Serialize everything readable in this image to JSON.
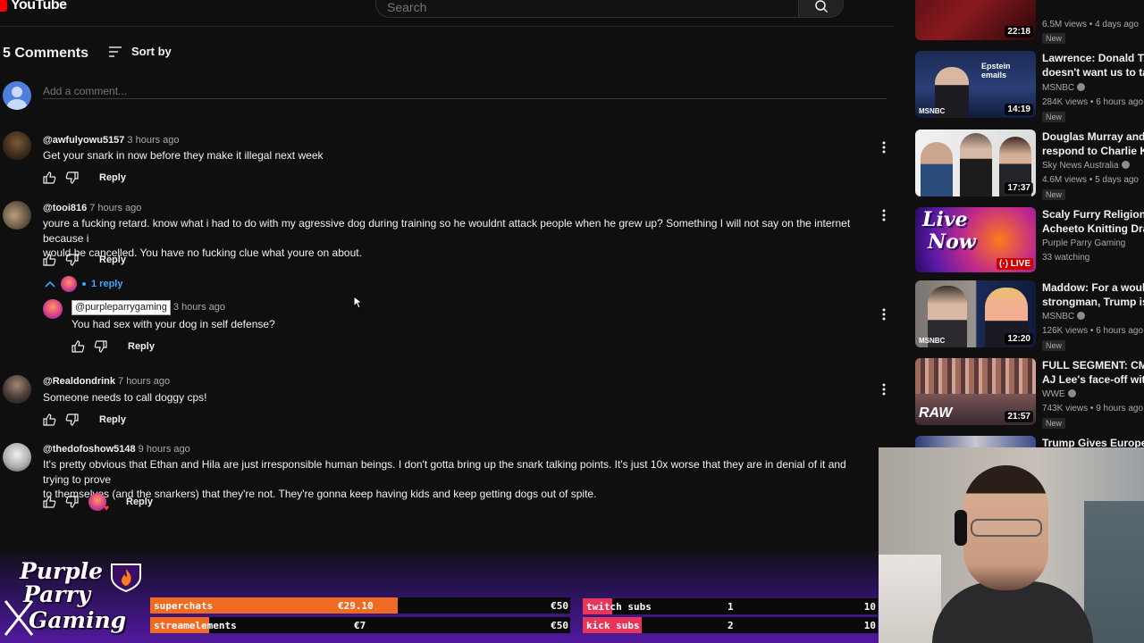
{
  "header": {
    "logo_text": "YouTube",
    "search_placeholder": "Search"
  },
  "comments_header": {
    "count_label": "5 Comments",
    "sort_label": "Sort by",
    "add_comment_placeholder": "Add a comment..."
  },
  "comments": [
    {
      "author": "@awfulyowu5157",
      "time": "3 hours ago",
      "text": "Get your snark in now before they make it illegal next week",
      "reply_label": "Reply"
    },
    {
      "author": "@tooi816",
      "time": "7 hours ago",
      "text_line1": "youre a fucking retard. know what i had to do with my agressive dog during training so he wouldnt attack people when he grew up? Something I will not say on the internet because i",
      "text_line2": "would be cancelled. You have no fucking clue what youre on about.",
      "reply_label": "Reply",
      "replies_toggle": "1 reply",
      "reply": {
        "author": "@purpleparrygaming",
        "time": "3 hours ago",
        "text": "You had sex with your dog in self defense?",
        "reply_label": "Reply"
      }
    },
    {
      "author": "@Realdondrink",
      "time": "7 hours ago",
      "text": "Someone needs to call doggy cps!",
      "reply_label": "Reply"
    },
    {
      "author": "@thedofoshow5148",
      "time": "9 hours ago",
      "text_line1": "It's pretty obvious that Ethan and Hila are just irresponsible human beings. I don't gotta bring up the snark talking points. It's just 10x worse that they are in denial of it and trying to prove",
      "text_line2": "to themselves (and the snarkers) that they're not. They're gonna keep having kids and keep getting dogs out of spite.",
      "reply_label": "Reply"
    }
  ],
  "related": [
    {
      "duration": "22:18",
      "meta": "6.5M views • 4 days ago",
      "new": "New"
    },
    {
      "title1": "Lawrence: Donald Trum",
      "title2": "doesn't want us to talk",
      "channel": "MSNBC",
      "meta": "284K views • 6 hours ago",
      "new": "New",
      "duration": "14:19",
      "thumb_caption": "Epstein emails",
      "thumb_brand": "MSNBC"
    },
    {
      "title1": "Douglas Murray and Ri",
      "title2": "respond to Charlie Kirk",
      "channel": "Sky News Australia",
      "meta": "4.6M views • 5 days ago",
      "new": "New",
      "duration": "17:37"
    },
    {
      "title1": "Scaly Furry Religion",
      "title2": "Acheeto Knitting Dram",
      "channel": "Purple Parry Gaming",
      "meta": "33 watching",
      "live": "LIVE",
      "thumb_line1": "Live",
      "thumb_line2": "Now"
    },
    {
      "title1": "Maddow: For a would-b",
      "title2": "strongman, Trump is p",
      "channel": "MSNBC",
      "meta": "126K views • 6 hours ago",
      "new": "New",
      "duration": "12:20",
      "thumb_brand": "MSNBC"
    },
    {
      "title1": "FULL SEGMENT: CM P",
      "title2": "AJ Lee's face-off with S",
      "channel": "WWE",
      "meta": "743K views • 9 hours ago",
      "new": "New",
      "duration": "21:57",
      "thumb_brand": "RAW"
    },
    {
      "title1": "Trump Gives Europe U"
    }
  ],
  "overlay": {
    "logo_line1": "Purple",
    "logo_line2": "Parry",
    "logo_line3": "Gaming",
    "superchats": {
      "label": "superchats",
      "value": "€29.10",
      "goal": "€50",
      "progress": 0.59
    },
    "streamelements": {
      "label": "streamelements",
      "value": "€7",
      "goal": "€50",
      "progress": 0.14
    },
    "twitch_subs": {
      "label": "twitch subs",
      "value": "1",
      "goal": "10",
      "progress": 0.1
    },
    "kick_subs": {
      "label": "kick subs",
      "value": "2",
      "goal": "10",
      "progress": 0.2
    }
  },
  "colors": {
    "background": "#0f0f0f",
    "bar_fill": "#f06a22",
    "overlay_purple": "#5519a5",
    "reply_link": "#3ea6ff",
    "live_red": "#cc0000"
  }
}
